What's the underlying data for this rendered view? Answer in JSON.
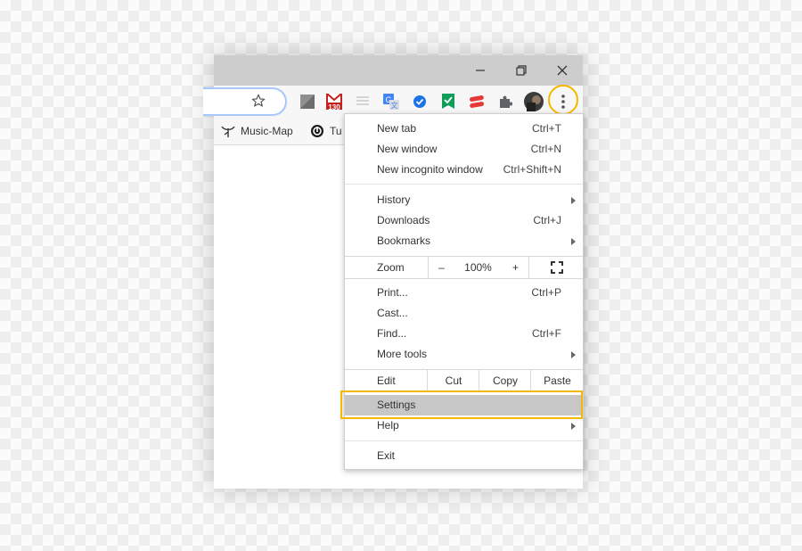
{
  "bookmarks": [
    {
      "label": "Music-Map",
      "icon": "music-map-icon"
    },
    {
      "label": "Tu",
      "icon": "circle-logo-icon"
    }
  ],
  "extensions": [
    {
      "icon": "gray-square-extension-icon"
    },
    {
      "icon": "gmail-extension-icon",
      "badge": "130"
    },
    {
      "icon": "lines-extension-icon"
    },
    {
      "icon": "google-translate-extension-icon"
    },
    {
      "icon": "check-extension-icon"
    },
    {
      "icon": "green-check-bookmark-extension-icon"
    },
    {
      "icon": "red-extension-icon"
    },
    {
      "icon": "puzzle-extensions-icon"
    },
    {
      "icon": "avatar"
    }
  ],
  "menu": {
    "group1": [
      {
        "label": "New tab",
        "shortcut": "Ctrl+T"
      },
      {
        "label": "New window",
        "shortcut": "Ctrl+N"
      },
      {
        "label": "New incognito window",
        "shortcut": "Ctrl+Shift+N"
      }
    ],
    "group2": [
      {
        "label": "History"
      },
      {
        "label": "Downloads",
        "shortcut": "Ctrl+J"
      },
      {
        "label": "Bookmarks"
      }
    ],
    "zoom": {
      "label": "Zoom",
      "minus": "–",
      "value": "100%",
      "plus": "+"
    },
    "group3": [
      {
        "label": "Print...",
        "shortcut": "Ctrl+P"
      },
      {
        "label": "Cast..."
      },
      {
        "label": "Find...",
        "shortcut": "Ctrl+F"
      },
      {
        "label": "More tools"
      }
    ],
    "edit": {
      "label": "Edit",
      "cut": "Cut",
      "copy": "Copy",
      "paste": "Paste"
    },
    "settings": "Settings",
    "help": "Help",
    "exit": "Exit"
  },
  "colors": {
    "highlight": "#f5b800",
    "titlebar": "#cdcdcd",
    "settings_bg": "#c7c7c7"
  }
}
